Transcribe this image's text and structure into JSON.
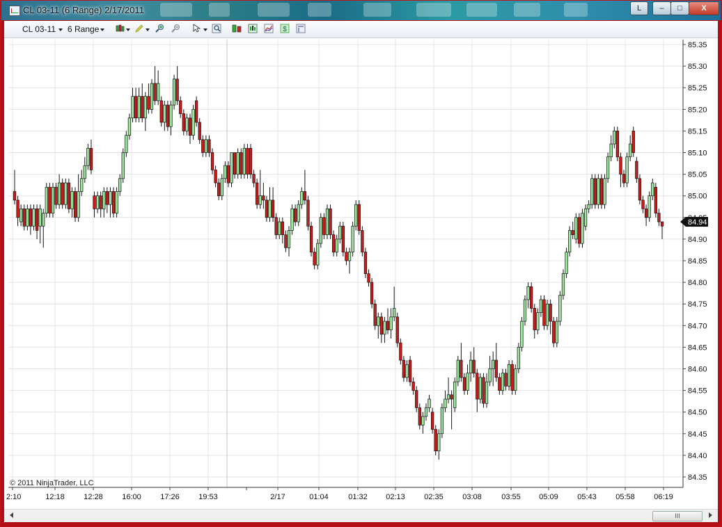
{
  "window": {
    "title": "CL 03-11 (6 Range)  2/17/2011",
    "buttons": {
      "extra": "L",
      "minimize": "–",
      "maximize": "□",
      "close": "X"
    }
  },
  "toolbar": {
    "instrument": "CL 03-11",
    "period": "6 Range",
    "icons": [
      "candlestick-icon",
      "pencil-icon",
      "zoom-in-icon",
      "zoom-out-icon",
      "cursor-icon",
      "search-icon",
      "data-box-icon",
      "properties-icon",
      "indicators-icon",
      "strategy-icon",
      "template-icon"
    ]
  },
  "copyright": "© 2011 NinjaTrader, LLC",
  "scrollbar": {
    "thumb_label": "III"
  },
  "colors": {
    "up": "#9be79b",
    "down": "#cf1a1a",
    "grid": "#e4e4e4",
    "wick": "#111111"
  },
  "chart_data": {
    "type": "candlestick",
    "x_tick_labels": [
      "2:10",
      "12:18",
      "12:28",
      "16:00",
      "17:26",
      "19:53",
      "",
      "2/17",
      "01:04",
      "01:32",
      "02:13",
      "02:35",
      "03:08",
      "03:55",
      "05:09",
      "05:43",
      "05:58",
      "06:19"
    ],
    "y_tick_labels": [
      "85.35",
      "85.30",
      "85.25",
      "85.20",
      "85.15",
      "85.10",
      "85.05",
      "85.00",
      "84.95",
      "84.90",
      "84.85",
      "84.80",
      "84.75",
      "84.70",
      "84.65",
      "84.60",
      "84.55",
      "84.50",
      "84.45",
      "84.40",
      "84.35"
    ],
    "ylim": [
      84.34,
      85.36
    ],
    "last_price": "84.94",
    "candles": [
      [
        "85.01",
        "84.99",
        "85.06",
        "84.98"
      ],
      [
        "84.99",
        "84.95",
        "85.00",
        "84.93"
      ],
      [
        "84.94",
        "84.97",
        "84.98",
        "84.93"
      ],
      [
        "84.97",
        "84.93",
        "84.98",
        "84.92"
      ],
      [
        "84.93",
        "84.97",
        "84.98",
        "84.92"
      ],
      [
        "84.97",
        "84.93",
        "84.98",
        "84.91"
      ],
      [
        "84.93",
        "84.97",
        "84.98",
        "84.92"
      ],
      [
        "84.97",
        "84.92",
        "84.98",
        "84.90"
      ],
      [
        "84.93",
        "84.97",
        "84.98",
        "84.89"
      ],
      [
        "84.93",
        "84.96",
        "84.97",
        "84.88"
      ],
      [
        "84.96",
        "85.02",
        "85.03",
        "84.95"
      ],
      [
        "85.02",
        "84.96",
        "85.03",
        "84.95"
      ],
      [
        "84.96",
        "85.02",
        "85.03",
        "84.95"
      ],
      [
        "85.02",
        "84.98",
        "85.03",
        "84.97"
      ],
      [
        "84.98",
        "85.03",
        "85.05",
        "84.97"
      ],
      [
        "85.03",
        "84.98",
        "85.04",
        "84.97"
      ],
      [
        "84.98",
        "85.03",
        "85.04",
        "84.97"
      ],
      [
        "85.03",
        "84.97",
        "85.04",
        "84.96"
      ],
      [
        "84.97",
        "85.01",
        "85.02",
        "84.95"
      ],
      [
        "85.01",
        "84.95",
        "85.02",
        "84.94"
      ],
      [
        "84.95",
        "85.01",
        "85.05",
        "84.94"
      ],
      [
        "85.01",
        "85.04",
        "85.06",
        "85.00"
      ],
      [
        "85.04",
        "85.07",
        "85.09",
        "85.03"
      ],
      [
        "85.07",
        "85.11",
        "85.12",
        "85.06"
      ],
      [
        "85.11",
        "85.06",
        "85.13",
        "85.05"
      ],
      [
        "85.00",
        "84.97",
        "85.01",
        "84.95"
      ],
      [
        "84.97",
        "85.00",
        "85.01",
        "84.96"
      ],
      [
        "85.00",
        "84.97",
        "85.01",
        "84.95"
      ],
      [
        "84.97",
        "85.01",
        "85.02",
        "84.95"
      ],
      [
        "85.01",
        "84.98",
        "85.02",
        "84.96"
      ],
      [
        "84.98",
        "85.01",
        "85.02",
        "84.95"
      ],
      [
        "85.01",
        "84.96",
        "85.02",
        "84.95"
      ],
      [
        "84.96",
        "85.01",
        "85.02",
        "84.95"
      ],
      [
        "85.01",
        "85.04",
        "85.05",
        "85.00"
      ],
      [
        "85.04",
        "85.10",
        "85.11",
        "85.03"
      ],
      [
        "85.10",
        "85.14",
        "85.15",
        "85.09"
      ],
      [
        "85.14",
        "85.18",
        "85.19",
        "85.13"
      ],
      [
        "85.18",
        "85.23",
        "85.25",
        "85.17"
      ],
      [
        "85.23",
        "85.18",
        "85.25",
        "85.17"
      ],
      [
        "85.18",
        "85.23",
        "85.25",
        "85.17"
      ],
      [
        "85.23",
        "85.18",
        "85.26",
        "85.17"
      ],
      [
        "85.18",
        "85.23",
        "85.24",
        "85.15"
      ],
      [
        "85.23",
        "85.20",
        "85.26",
        "85.19"
      ],
      [
        "85.20",
        "85.26",
        "85.27",
        "85.19"
      ],
      [
        "85.26",
        "85.22",
        "85.30",
        "85.21"
      ],
      [
        "85.22",
        "85.26",
        "85.29",
        "85.21"
      ],
      [
        "85.22",
        "85.17",
        "85.23",
        "85.16"
      ],
      [
        "85.17",
        "85.21",
        "85.22",
        "85.15"
      ],
      [
        "85.21",
        "85.16",
        "85.22",
        "85.15"
      ],
      [
        "85.16",
        "85.21",
        "85.22",
        "85.14"
      ],
      [
        "85.21",
        "85.27",
        "85.28",
        "85.20"
      ],
      [
        "85.27",
        "85.22",
        "85.30",
        "85.21"
      ],
      [
        "85.22",
        "85.19",
        "85.23",
        "85.18"
      ],
      [
        "85.19",
        "85.15",
        "85.20",
        "85.14"
      ],
      [
        "85.15",
        "85.18",
        "85.19",
        "85.14"
      ],
      [
        "85.18",
        "85.14",
        "85.19",
        "85.12"
      ],
      [
        "85.14",
        "85.20",
        "85.21",
        "85.13"
      ],
      [
        "85.22",
        "85.17",
        "85.23",
        "85.16"
      ],
      [
        "85.17",
        "85.13",
        "85.18",
        "85.12"
      ],
      [
        "85.13",
        "85.10",
        "85.14",
        "85.09"
      ],
      [
        "85.10",
        "85.13",
        "85.14",
        "85.09"
      ],
      [
        "85.13",
        "85.10",
        "85.14",
        "85.09"
      ],
      [
        "85.10",
        "85.06",
        "85.11",
        "85.05"
      ],
      [
        "85.06",
        "85.03",
        "85.07",
        "85.02"
      ],
      [
        "85.03",
        "85.00",
        "85.04",
        "84.99"
      ],
      [
        "85.00",
        "85.04",
        "85.05",
        "84.99"
      ],
      [
        "85.04",
        "85.07",
        "85.08",
        "85.03"
      ],
      [
        "85.07",
        "85.03",
        "85.08",
        "85.02"
      ],
      [
        "85.03",
        "85.10",
        "85.10",
        "85.02"
      ],
      [
        "85.10",
        "85.05",
        "85.10",
        "85.04"
      ],
      [
        "85.05",
        "85.10",
        "85.11",
        "85.04"
      ],
      [
        "85.10",
        "85.05",
        "85.11",
        "85.04"
      ],
      [
        "85.05",
        "85.11",
        "85.12",
        "85.04"
      ],
      [
        "85.11",
        "85.05",
        "85.12",
        "85.04"
      ],
      [
        "85.11",
        "85.05",
        "85.12",
        "85.04"
      ],
      [
        "85.05",
        "85.03",
        "85.06",
        "85.02"
      ],
      [
        "85.03",
        "84.98",
        "85.04",
        "84.97"
      ],
      [
        "84.98",
        "85.00",
        "85.06",
        "84.97"
      ],
      [
        "85.00",
        "84.99",
        "85.03",
        "84.97"
      ],
      [
        "84.99",
        "84.95",
        "85.00",
        "84.94"
      ],
      [
        "84.95",
        "84.99",
        "85.02",
        "84.94"
      ],
      [
        "84.99",
        "84.95",
        "85.02",
        "84.94"
      ],
      [
        "84.95",
        "84.91",
        "84.96",
        "84.90"
      ],
      [
        "84.91",
        "84.94",
        "84.95",
        "84.90"
      ],
      [
        "84.94",
        "84.91",
        "84.95",
        "84.89"
      ],
      [
        "84.91",
        "84.88",
        "84.92",
        "84.87"
      ],
      [
        "84.88",
        "84.92",
        "84.93",
        "84.86"
      ],
      [
        "84.92",
        "84.97",
        "84.98",
        "84.91"
      ],
      [
        "84.97",
        "84.94",
        "84.98",
        "84.93"
      ],
      [
        "84.94",
        "84.98",
        "84.99",
        "84.93"
      ],
      [
        "84.98",
        "85.01",
        "85.02",
        "84.97"
      ],
      [
        "85.01",
        "84.99",
        "85.06",
        "84.98"
      ],
      [
        "84.99",
        "84.93",
        "85.00",
        "84.92"
      ],
      [
        "84.93",
        "84.87",
        "84.94",
        "84.86"
      ],
      [
        "84.87",
        "84.84",
        "84.88",
        "84.83"
      ],
      [
        "84.84",
        "84.89",
        "84.90",
        "84.83"
      ],
      [
        "84.89",
        "84.95",
        "84.96",
        "84.88"
      ],
      [
        "84.95",
        "84.91",
        "84.96",
        "84.90"
      ],
      [
        "84.91",
        "84.97",
        "84.98",
        "84.90"
      ],
      [
        "84.97",
        "84.91",
        "84.98",
        "84.90"
      ],
      [
        "84.91",
        "84.87",
        "84.92",
        "84.86"
      ],
      [
        "84.87",
        "84.90",
        "84.91",
        "84.86"
      ],
      [
        "84.90",
        "84.93",
        "84.94",
        "84.89"
      ],
      [
        "84.93",
        "84.87",
        "84.94",
        "84.86"
      ],
      [
        "84.87",
        "84.85",
        "84.88",
        "84.84"
      ],
      [
        "84.85",
        "84.87",
        "84.88",
        "84.82"
      ],
      [
        "84.87",
        "84.93",
        "84.94",
        "84.86"
      ],
      [
        "84.93",
        "84.98",
        "84.99",
        "84.92"
      ],
      [
        "84.98",
        "84.92",
        "84.99",
        "84.91"
      ],
      [
        "84.92",
        "84.87",
        "84.93",
        "84.86"
      ],
      [
        "84.87",
        "84.82",
        "84.88",
        "84.81"
      ],
      [
        "84.82",
        "84.80",
        "84.83",
        "84.79"
      ],
      [
        "84.80",
        "84.75",
        "84.81",
        "84.74"
      ],
      [
        "84.75",
        "84.70",
        "84.76",
        "84.69"
      ],
      [
        "84.70",
        "84.72",
        "84.73",
        "84.67"
      ],
      [
        "84.72",
        "84.68",
        "84.73",
        "84.66"
      ],
      [
        "84.68",
        "84.71",
        "84.72",
        "84.66"
      ],
      [
        "84.71",
        "84.69",
        "84.74",
        "84.68"
      ],
      [
        "84.69",
        "84.72",
        "84.74",
        "84.67"
      ],
      [
        "84.72",
        "84.74",
        "84.79",
        "84.71"
      ],
      [
        "84.72",
        "84.66",
        "84.73",
        "84.65"
      ],
      [
        "84.66",
        "84.62",
        "84.67",
        "84.61"
      ],
      [
        "84.62",
        "84.58",
        "84.63",
        "84.57"
      ],
      [
        "84.58",
        "84.61",
        "84.62",
        "84.57"
      ],
      [
        "84.62",
        "84.57",
        "84.63",
        "84.56"
      ],
      [
        "84.57",
        "84.55",
        "84.58",
        "84.54"
      ],
      [
        "84.55",
        "84.51",
        "84.56",
        "84.50"
      ],
      [
        "84.51",
        "84.47",
        "84.52",
        "84.46"
      ],
      [
        "84.47",
        "84.49",
        "84.50",
        "84.45"
      ],
      [
        "84.49",
        "84.51",
        "84.52",
        "84.48"
      ],
      [
        "84.51",
        "84.53",
        "84.54",
        "84.50"
      ],
      [
        "84.50",
        "84.46",
        "84.51",
        "84.45"
      ],
      [
        "84.46",
        "84.41",
        "84.47",
        "84.40"
      ],
      [
        "84.41",
        "84.45",
        "84.46",
        "84.39"
      ],
      [
        "84.45",
        "84.51",
        "84.52",
        "84.44"
      ],
      [
        "84.51",
        "84.53",
        "84.55",
        "84.50"
      ],
      [
        "84.53",
        "84.54",
        "84.58",
        "84.52"
      ],
      [
        "84.54",
        "84.53",
        "84.55",
        "84.46"
      ],
      [
        "84.51",
        "84.57",
        "84.58",
        "84.50"
      ],
      [
        "84.57",
        "84.62",
        "84.63",
        "84.56"
      ],
      [
        "84.62",
        "84.58",
        "84.66",
        "84.57"
      ],
      [
        "84.58",
        "84.55",
        "84.59",
        "84.54"
      ],
      [
        "84.55",
        "84.59",
        "84.61",
        "84.54"
      ],
      [
        "84.59",
        "84.62",
        "84.64",
        "84.57"
      ],
      [
        "84.62",
        "84.59",
        "84.65",
        "84.58"
      ],
      [
        "84.59",
        "84.53",
        "84.60",
        "84.50"
      ],
      [
        "84.53",
        "84.58",
        "84.59",
        "84.52"
      ],
      [
        "84.58",
        "84.52",
        "84.59",
        "84.51"
      ],
      [
        "84.52",
        "84.57",
        "84.59",
        "84.51"
      ],
      [
        "84.57",
        "84.60",
        "84.63",
        "84.56"
      ],
      [
        "84.60",
        "84.62",
        "84.64",
        "84.56"
      ],
      [
        "84.62",
        "84.58",
        "84.66",
        "84.57"
      ],
      [
        "84.58",
        "84.55",
        "84.59",
        "84.54"
      ],
      [
        "84.55",
        "84.59",
        "84.60",
        "84.54"
      ],
      [
        "84.59",
        "84.56",
        "84.60",
        "84.55"
      ],
      [
        "84.56",
        "84.61",
        "84.62",
        "84.55"
      ],
      [
        "84.61",
        "84.55",
        "84.62",
        "84.54"
      ],
      [
        "84.55",
        "84.60",
        "84.61",
        "84.54"
      ],
      [
        "84.60",
        "84.65",
        "84.66",
        "84.59"
      ],
      [
        "84.65",
        "84.71",
        "84.72",
        "84.64"
      ],
      [
        "84.71",
        "84.76",
        "84.77",
        "84.70"
      ],
      [
        "84.76",
        "84.79",
        "84.80",
        "84.74"
      ],
      [
        "84.79",
        "84.74",
        "84.80",
        "84.73"
      ],
      [
        "84.74",
        "84.69",
        "84.75",
        "84.67"
      ],
      [
        "84.69",
        "84.73",
        "84.74",
        "84.68"
      ],
      [
        "84.73",
        "84.76",
        "84.77",
        "84.72"
      ],
      [
        "84.76",
        "84.70",
        "84.77",
        "84.69"
      ],
      [
        "84.70",
        "84.75",
        "84.76",
        "84.69"
      ],
      [
        "84.75",
        "84.71",
        "84.76",
        "84.68"
      ],
      [
        "84.71",
        "84.66",
        "84.72",
        "84.65"
      ],
      [
        "84.66",
        "84.71",
        "84.72",
        "84.65"
      ],
      [
        "84.71",
        "84.77",
        "84.78",
        "84.70"
      ],
      [
        "84.77",
        "84.82",
        "84.83",
        "84.76"
      ],
      [
        "84.82",
        "84.87",
        "84.88",
        "84.81"
      ],
      [
        "84.87",
        "84.92",
        "84.93",
        "84.86"
      ],
      [
        "84.92",
        "84.91",
        "84.94",
        "84.90"
      ],
      [
        "84.90",
        "84.95",
        "84.96",
        "84.89"
      ],
      [
        "84.95",
        "84.89",
        "84.96",
        "84.88"
      ],
      [
        "84.89",
        "84.96",
        "84.97",
        "84.88"
      ],
      [
        "84.93",
        "84.97",
        "84.98",
        "84.92"
      ],
      [
        "84.97",
        "84.98",
        "84.99",
        "84.96"
      ],
      [
        "84.98",
        "85.04",
        "85.05",
        "84.97"
      ],
      [
        "85.04",
        "84.98",
        "85.05",
        "84.97"
      ],
      [
        "84.98",
        "85.04",
        "85.05",
        "84.97"
      ],
      [
        "85.04",
        "84.98",
        "85.05",
        "84.97"
      ],
      [
        "84.98",
        "85.04",
        "85.05",
        "84.97"
      ],
      [
        "85.04",
        "85.09",
        "85.10",
        "85.03"
      ],
      [
        "85.09",
        "85.12",
        "85.14",
        "85.08"
      ],
      [
        "85.12",
        "85.15",
        "85.16",
        "85.11"
      ],
      [
        "85.15",
        "85.09",
        "85.16",
        "85.08"
      ],
      [
        "85.09",
        "85.05",
        "85.10",
        "85.02"
      ],
      [
        "85.05",
        "85.03",
        "85.06",
        "85.02"
      ],
      [
        "85.03",
        "85.09",
        "85.10",
        "85.02"
      ],
      [
        "85.09",
        "85.12",
        "85.14",
        "85.08"
      ],
      [
        "85.15",
        "85.10",
        "85.16",
        "85.09"
      ],
      [
        "85.08",
        "85.04",
        "85.09",
        "85.03"
      ],
      [
        "85.04",
        "84.99",
        "85.05",
        "84.98"
      ],
      [
        "84.99",
        "84.97",
        "85.00",
        "84.96"
      ],
      [
        "84.97",
        "84.95",
        "84.98",
        "84.93"
      ],
      [
        "84.95",
        "85.00",
        "85.01",
        "84.94"
      ],
      [
        "85.00",
        "85.03",
        "85.04",
        "84.99"
      ],
      [
        "85.02",
        "84.96",
        "85.03",
        "84.95"
      ],
      [
        "84.96",
        "84.94",
        "84.97",
        "84.93"
      ],
      [
        "84.94",
        "84.93",
        "84.94",
        "84.90"
      ]
    ]
  }
}
